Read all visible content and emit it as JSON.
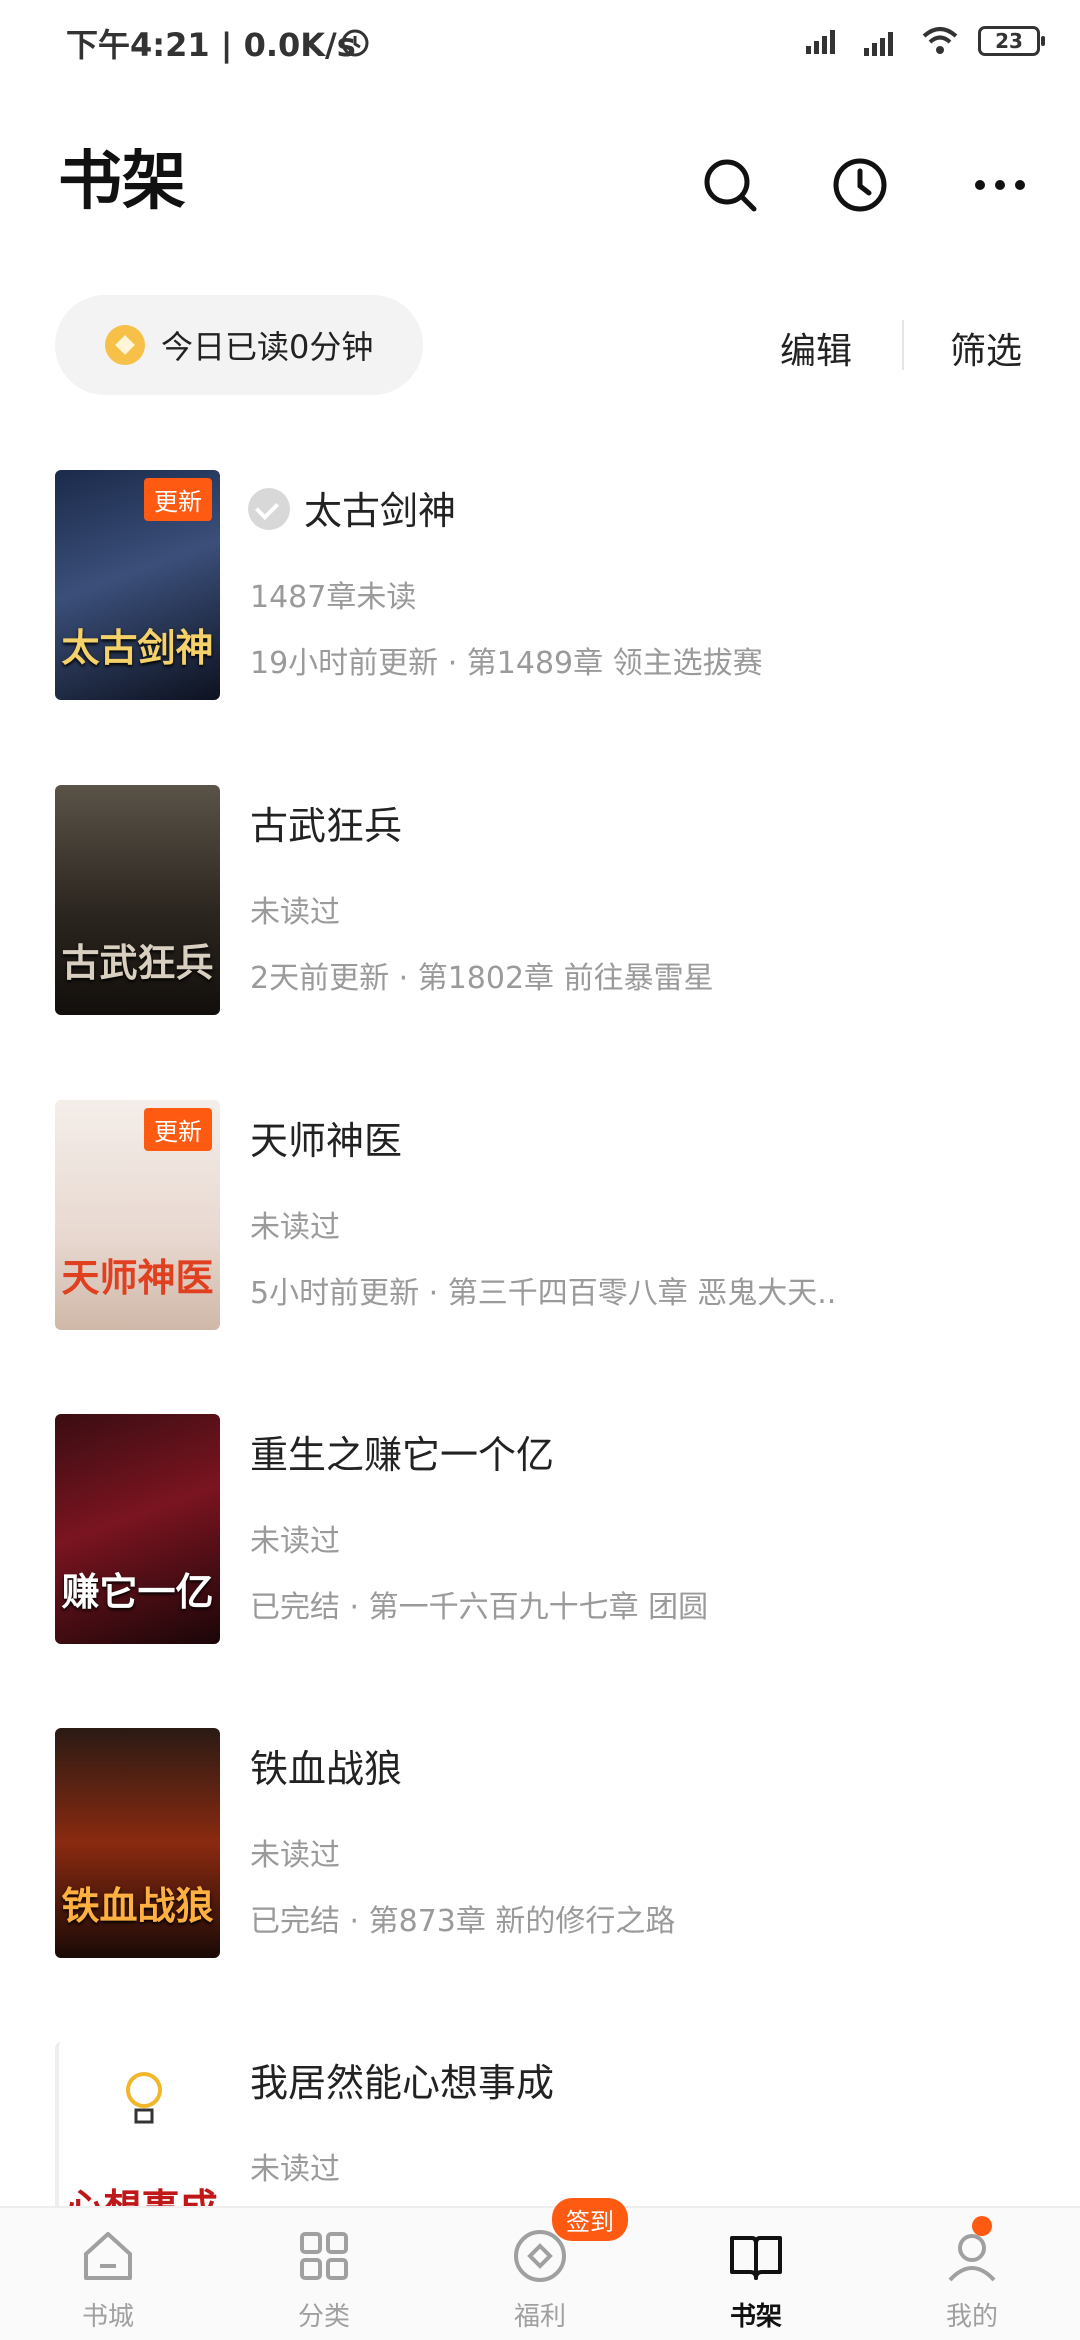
{
  "status": {
    "time": "下午4:21 | 0.0K/s",
    "battery": "23"
  },
  "header": {
    "title": "书架"
  },
  "toolbar": {
    "read_today": "今日已读0分钟",
    "edit_label": "编辑",
    "filter_label": "筛选"
  },
  "books": [
    {
      "title": "太古剑神",
      "sub": "1487章未读",
      "meta": "19小时前更新 · 第1489章 领主选拔赛",
      "badge": "更新",
      "cover_text": "太古剑神"
    },
    {
      "title": "古武狂兵",
      "sub": "未读过",
      "meta": "2天前更新 · 第1802章 前往暴雷星",
      "badge": "",
      "cover_text": "古武狂兵"
    },
    {
      "title": "天师神医",
      "sub": "未读过",
      "meta": "5小时前更新 · 第三千四百零八章 恶鬼大天..",
      "badge": "更新",
      "cover_text": "天师神医"
    },
    {
      "title": "重生之赚它一个亿",
      "sub": "未读过",
      "meta": "已完结 · 第一千六百九十七章 团圆",
      "badge": "",
      "cover_text": "赚它一亿"
    },
    {
      "title": "铁血战狼",
      "sub": "未读过",
      "meta": "已完结 · 第873章 新的修行之路",
      "badge": "",
      "cover_text": "铁血战狼"
    },
    {
      "title": "我居然能心想事成",
      "sub": "未读过",
      "meta": "",
      "badge": "",
      "cover_text": "心想事成"
    }
  ],
  "nav": {
    "store": "书城",
    "category": "分类",
    "welfare": "福利",
    "welfare_badge": "签到",
    "shelf": "书架",
    "mine": "我的"
  },
  "colors": {
    "accent": "#ff5a12"
  }
}
